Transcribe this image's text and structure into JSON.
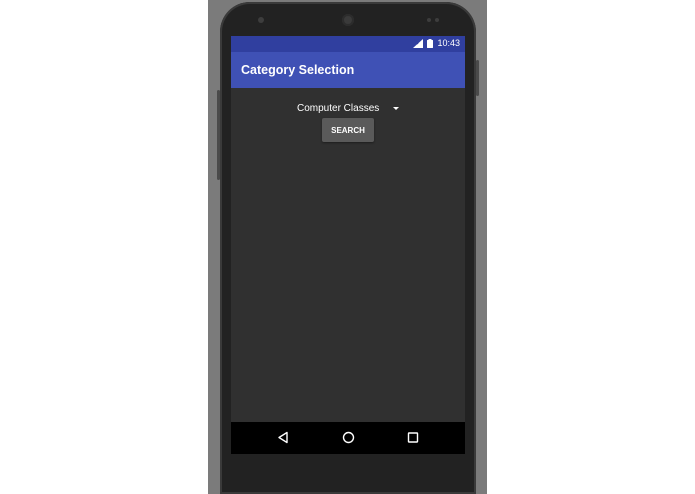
{
  "status_bar": {
    "time": "10:43",
    "color": "#303f9f"
  },
  "app_bar": {
    "title": "Category Selection",
    "color": "#3f51b5"
  },
  "content": {
    "spinner_value": "Computer Classes",
    "search_label": "SEARCH"
  },
  "nav": {
    "icons": [
      "back-icon",
      "home-icon",
      "recents-icon"
    ]
  }
}
